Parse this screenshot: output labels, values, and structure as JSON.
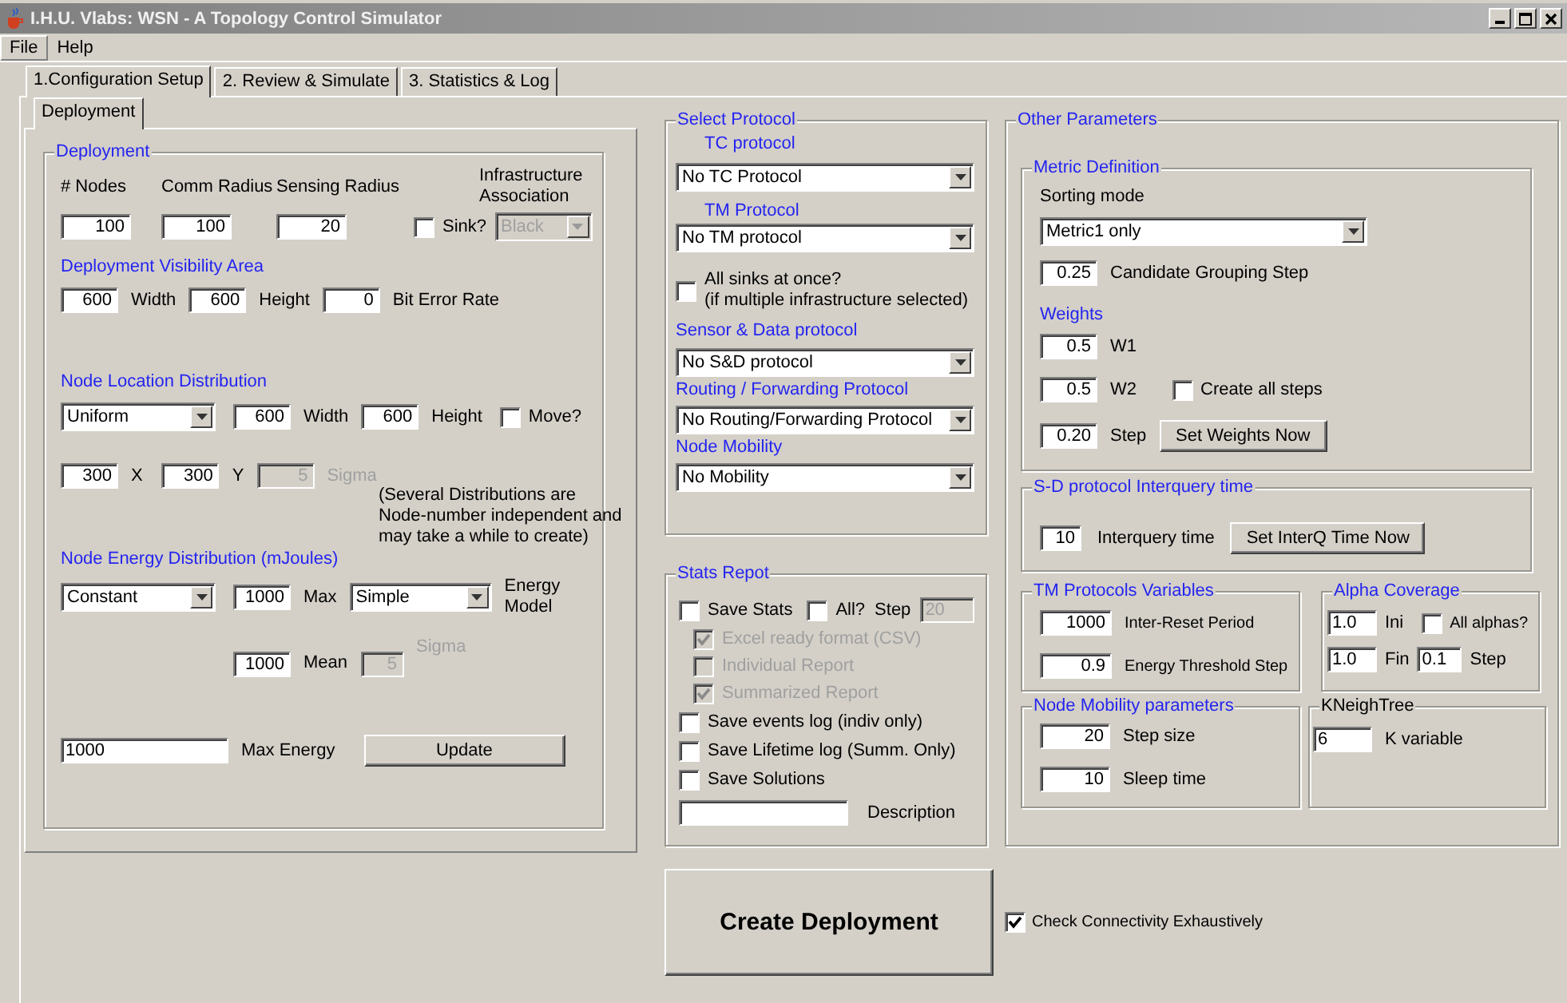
{
  "window": {
    "title": "I.H.U. Vlabs: WSN - A Topology Control Simulator"
  },
  "menu": [
    {
      "label": "File",
      "selected": true
    },
    {
      "label": "Help",
      "selected": false
    }
  ],
  "tabs": [
    {
      "label": "1.Configuration Setup",
      "selected": true
    },
    {
      "label": "2. Review & Simulate",
      "selected": false
    },
    {
      "label": "3. Statistics & Log",
      "selected": false
    }
  ],
  "subtabs": [
    {
      "label": "Deployment",
      "selected": true
    }
  ],
  "deployment": {
    "title": "Deployment",
    "rows": [
      {
        "items": [
          {
            "kind": "label",
            "text": "# Nodes",
            "disabled": false
          },
          {
            "kind": "label",
            "text": "Comm Radius",
            "disabled": false
          },
          {
            "kind": "label",
            "text": "Sensing Radius",
            "disabled": false
          },
          {
            "kind": "label",
            "text": "Infrastructure\nAssociation",
            "disabled": false
          }
        ]
      },
      {
        "items": [
          {
            "kind": "field",
            "value": "100",
            "disabled": false
          },
          {
            "kind": "field",
            "value": "100",
            "disabled": false
          },
          {
            "kind": "field",
            "value": "20",
            "disabled": false
          },
          {
            "kind": "checkbox",
            "label": "Sink?",
            "checked": false,
            "disabled": false
          },
          {
            "kind": "combo",
            "value": "Black",
            "disabled": true
          }
        ]
      },
      {
        "items": [
          {
            "kind": "heading",
            "text": "Deployment Visibility Area"
          }
        ]
      },
      {
        "items": [
          {
            "kind": "field",
            "value": "600",
            "disabled": false
          },
          {
            "kind": "label",
            "text": "Width",
            "disabled": false
          },
          {
            "kind": "field",
            "value": "600",
            "disabled": false
          },
          {
            "kind": "label",
            "text": "Height",
            "disabled": false
          },
          {
            "kind": "field",
            "value": "0",
            "disabled": false
          },
          {
            "kind": "label",
            "text": "Bit Error Rate",
            "disabled": false
          }
        ]
      },
      {
        "items": [
          {
            "kind": "heading",
            "text": "Node Location Distribution"
          }
        ]
      },
      {
        "items": [
          {
            "kind": "combo",
            "value": "Uniform",
            "disabled": false
          },
          {
            "kind": "field",
            "value": "600",
            "disabled": false
          },
          {
            "kind": "label",
            "text": "Width",
            "disabled": false
          },
          {
            "kind": "field",
            "value": "600",
            "disabled": false
          },
          {
            "kind": "label",
            "text": "Height",
            "disabled": false
          },
          {
            "kind": "checkbox",
            "label": "Move?",
            "checked": false,
            "disabled": false
          }
        ]
      },
      {
        "items": [
          {
            "kind": "field",
            "value": "300",
            "disabled": false
          },
          {
            "kind": "label",
            "text": "X",
            "disabled": false
          },
          {
            "kind": "field",
            "value": "300",
            "disabled": false
          },
          {
            "kind": "label",
            "text": "Y",
            "disabled": false
          },
          {
            "kind": "field",
            "value": "5",
            "disabled": true
          },
          {
            "kind": "label",
            "text": "Sigma",
            "disabled": true
          }
        ]
      },
      {
        "items": [
          {
            "kind": "note",
            "text": "(Several Distributions are\nNode-number independent and\nmay take a while to create)"
          }
        ]
      },
      {
        "items": [
          {
            "kind": "heading",
            "text": "Node Energy Distribution (mJoules)"
          }
        ]
      },
      {
        "items": [
          {
            "kind": "combo",
            "value": "Constant",
            "disabled": false
          },
          {
            "kind": "field",
            "value": "1000",
            "disabled": false
          },
          {
            "kind": "label",
            "text": "Max",
            "disabled": false
          },
          {
            "kind": "combo",
            "value": "Simple",
            "disabled": false
          },
          {
            "kind": "label",
            "text": "Energy\nModel",
            "disabled": false
          }
        ]
      },
      {
        "items": [
          {
            "kind": "field",
            "value": "1000",
            "disabled": false
          },
          {
            "kind": "label",
            "text": "Mean",
            "disabled": false
          },
          {
            "kind": "field",
            "value": "5",
            "disabled": true
          },
          {
            "kind": "label",
            "text": "Sigma",
            "disabled": true
          }
        ]
      },
      {
        "items": [
          {
            "kind": "field",
            "value": "1000",
            "disabled": false
          },
          {
            "kind": "label",
            "text": "Max Energy",
            "disabled": false
          },
          {
            "kind": "button",
            "label": "Update"
          }
        ]
      }
    ]
  },
  "select_protocol": {
    "title": "Select Protocol",
    "rows": [
      {
        "items": [
          {
            "kind": "heading",
            "text": "TC protocol"
          }
        ]
      },
      {
        "items": [
          {
            "kind": "combo",
            "value": "No TC Protocol",
            "disabled": false
          }
        ]
      },
      {
        "items": [
          {
            "kind": "heading",
            "text": "TM Protocol"
          }
        ]
      },
      {
        "items": [
          {
            "kind": "combo",
            "value": "No TM protocol",
            "disabled": false
          }
        ]
      },
      {
        "items": [
          {
            "kind": "checkbox",
            "label": "All sinks at once?\n(if multiple infrastructure selected)",
            "checked": false,
            "disabled": false
          }
        ]
      },
      {
        "items": [
          {
            "kind": "heading",
            "text": "Sensor & Data protocol"
          }
        ]
      },
      {
        "items": [
          {
            "kind": "combo",
            "value": "No S&D protocol",
            "disabled": false
          }
        ]
      },
      {
        "items": [
          {
            "kind": "heading",
            "text": "Routing / Forwarding Protocol"
          }
        ]
      },
      {
        "items": [
          {
            "kind": "combo",
            "value": "No Routing/Forwarding Protocol",
            "disabled": false
          }
        ]
      },
      {
        "items": [
          {
            "kind": "heading",
            "text": "Node Mobility"
          }
        ]
      },
      {
        "items": [
          {
            "kind": "combo",
            "value": "No Mobility",
            "disabled": false
          }
        ]
      }
    ]
  },
  "stats_report": {
    "title": "Stats Repot",
    "rows": [
      {
        "items": [
          {
            "kind": "checkbox",
            "label": "Save Stats",
            "checked": false,
            "disabled": false
          },
          {
            "kind": "checkbox",
            "label": "All?",
            "checked": false,
            "disabled": false
          },
          {
            "kind": "label",
            "text": "Step",
            "disabled": false
          },
          {
            "kind": "field",
            "value": "20",
            "disabled": true
          }
        ]
      },
      {
        "items": [
          {
            "kind": "checkbox",
            "label": "Excel ready format (CSV)",
            "checked": true,
            "disabled": true
          }
        ]
      },
      {
        "items": [
          {
            "kind": "checkbox",
            "label": "Individual Report",
            "checked": false,
            "disabled": true
          }
        ]
      },
      {
        "items": [
          {
            "kind": "checkbox",
            "label": "Summarized Report",
            "checked": true,
            "disabled": true
          }
        ]
      },
      {
        "items": [
          {
            "kind": "checkbox",
            "label": "Save events log (indiv only)",
            "checked": false,
            "disabled": false
          }
        ]
      },
      {
        "items": [
          {
            "kind": "checkbox",
            "label": "Save Lifetime log (Summ. Only)",
            "checked": false,
            "disabled": false
          }
        ]
      },
      {
        "items": [
          {
            "kind": "checkbox",
            "label": "Save Solutions",
            "checked": false,
            "disabled": false
          }
        ]
      },
      {
        "items": [
          {
            "kind": "field",
            "disabled": false
          },
          {
            "kind": "label",
            "text": "Description",
            "disabled": false
          }
        ]
      }
    ]
  },
  "other_parameters": {
    "title": "Other Parameters",
    "group_rows": [
      {
        "groups": [
          {
            "title": "Metric Definition",
            "rows": [
              {
                "items": [
                  {
                    "kind": "label",
                    "text": "Sorting mode",
                    "disabled": false
                  }
                ]
              },
              {
                "items": [
                  {
                    "kind": "combo",
                    "value": "Metric1 only",
                    "disabled": false
                  }
                ]
              },
              {
                "items": [
                  {
                    "kind": "field",
                    "value": "0.25",
                    "disabled": false
                  },
                  {
                    "kind": "label",
                    "text": "Candidate Grouping Step",
                    "disabled": false
                  }
                ]
              },
              {
                "items": [
                  {
                    "kind": "heading",
                    "text": "Weights"
                  }
                ]
              },
              {
                "items": [
                  {
                    "kind": "field",
                    "value": "0.5",
                    "disabled": false
                  },
                  {
                    "kind": "label",
                    "text": "W1",
                    "disabled": false
                  }
                ]
              },
              {
                "items": [
                  {
                    "kind": "field",
                    "value": "0.5",
                    "disabled": false
                  },
                  {
                    "kind": "label",
                    "text": "W2",
                    "disabled": false
                  },
                  {
                    "kind": "checkbox",
                    "label": "Create all steps",
                    "checked": false,
                    "disabled": false
                  }
                ]
              },
              {
                "items": [
                  {
                    "kind": "field",
                    "value": "0.20",
                    "disabled": false
                  },
                  {
                    "kind": "label",
                    "text": "Step",
                    "disabled": false
                  },
                  {
                    "kind": "button",
                    "label": "Set Weights Now"
                  }
                ]
              }
            ]
          }
        ]
      },
      {
        "groups": [
          {
            "title": "S-D protocol Interquery time",
            "rows": [
              {
                "items": [
                  {
                    "kind": "field",
                    "value": "10",
                    "disabled": false
                  },
                  {
                    "kind": "label",
                    "text": "Interquery time",
                    "disabled": false
                  },
                  {
                    "kind": "button",
                    "label": "Set InterQ Time Now"
                  }
                ]
              }
            ]
          }
        ]
      },
      {
        "groups": [
          {
            "title": "TM Protocols Variables",
            "rows": [
              {
                "items": [
                  {
                    "kind": "field",
                    "value": "1000",
                    "disabled": false
                  },
                  {
                    "kind": "label",
                    "text": "Inter-Reset Period",
                    "disabled": false
                  }
                ]
              },
              {
                "items": [
                  {
                    "kind": "field",
                    "value": "0.9",
                    "disabled": false
                  },
                  {
                    "kind": "label",
                    "text": "Energy Threshold Step",
                    "disabled": false
                  }
                ]
              }
            ]
          },
          {
            "title": "Alpha Coverage",
            "rows": [
              {
                "items": [
                  {
                    "kind": "field",
                    "value": "1.0",
                    "disabled": false
                  },
                  {
                    "kind": "label",
                    "text": "Ini",
                    "disabled": false
                  },
                  {
                    "kind": "checkbox",
                    "label": "All alphas?",
                    "checked": false,
                    "disabled": false
                  }
                ]
              },
              {
                "items": [
                  {
                    "kind": "field",
                    "value": "1.0",
                    "disabled": false
                  },
                  {
                    "kind": "label",
                    "text": "Fin",
                    "disabled": false
                  },
                  {
                    "kind": "field",
                    "value": "0.1",
                    "disabled": false
                  },
                  {
                    "kind": "label",
                    "text": "Step",
                    "disabled": false
                  }
                ]
              }
            ]
          }
        ]
      },
      {
        "groups": [
          {
            "title": "Node Mobility parameters",
            "rows": [
              {
                "items": [
                  {
                    "kind": "field",
                    "value": "20",
                    "disabled": false
                  },
                  {
                    "kind": "label",
                    "text": "Step size",
                    "disabled": false
                  }
                ]
              },
              {
                "items": [
                  {
                    "kind": "field",
                    "value": "10",
                    "disabled": false
                  },
                  {
                    "kind": "label",
                    "text": "Sleep time",
                    "disabled": false
                  }
                ]
              }
            ]
          },
          {
            "title": "KNeighTree",
            "rows": [
              {
                "items": [
                  {
                    "kind": "field",
                    "value": "6",
                    "disabled": false
                  },
                  {
                    "kind": "label",
                    "text": "K variable",
                    "disabled": false
                  }
                ]
              }
            ]
          }
        ]
      }
    ]
  },
  "create_button": {
    "label": "Create Deployment"
  },
  "check_connectivity": {
    "label": "Check Connectivity Exhaustively",
    "checked": true
  }
}
